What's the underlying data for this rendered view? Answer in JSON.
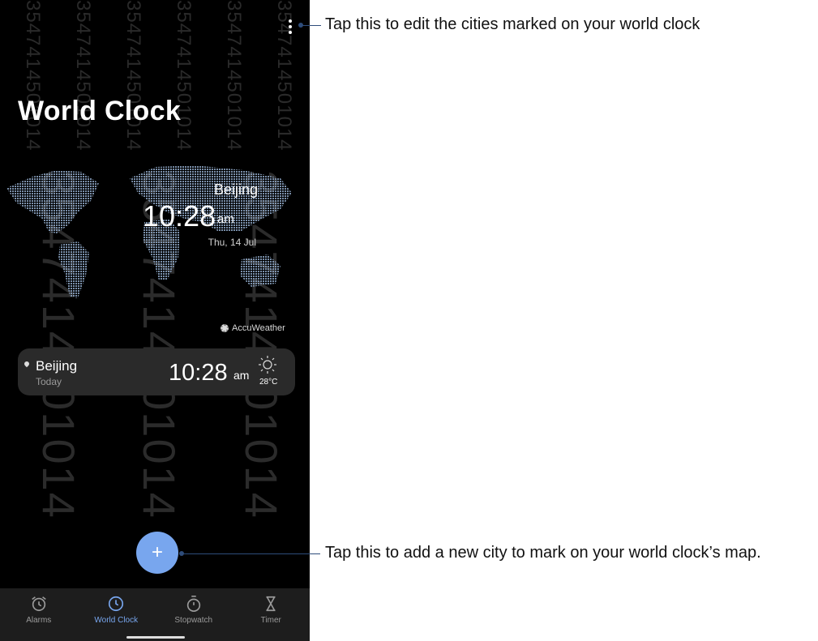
{
  "screen": {
    "title": "World Clock",
    "watermark": "3547414501014",
    "map": {
      "city": "Beijing",
      "time": "10:28",
      "ampm": "am",
      "date": "Thu, 14 Jul",
      "provider": "AccuWeather"
    },
    "cities": [
      {
        "name": "Beijing",
        "day": "Today",
        "time": "10:28",
        "ampm": "am",
        "temperature": "28°C",
        "weather_icon": "sun-icon"
      }
    ],
    "fab": {
      "label": "+",
      "icon": "plus-icon"
    },
    "nav": [
      {
        "label": "Alarms",
        "icon": "alarm-icon",
        "active": false
      },
      {
        "label": "World Clock",
        "icon": "clock-icon",
        "active": true
      },
      {
        "label": "Stopwatch",
        "icon": "stopwatch-icon",
        "active": false
      },
      {
        "label": "Timer",
        "icon": "hourglass-icon",
        "active": false
      }
    ]
  },
  "callouts": {
    "menu": "Tap this to edit the cities marked on your world clock",
    "add": "Tap this to add a new city to mark on your world clock’s map."
  },
  "colors": {
    "accent": "#78a6ee",
    "callout": "#2e4c7a",
    "card": "#2a2a2a",
    "nav": "#1d1d1d"
  }
}
